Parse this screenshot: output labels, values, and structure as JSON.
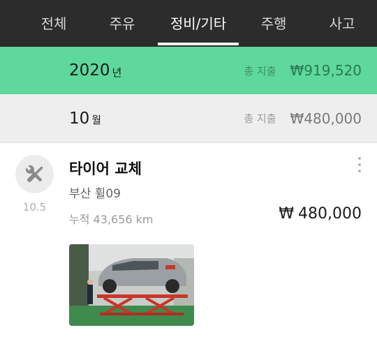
{
  "tabs": [
    {
      "label": "전체"
    },
    {
      "label": "주유"
    },
    {
      "label": "정비/기타"
    },
    {
      "label": "주행"
    },
    {
      "label": "사고"
    }
  ],
  "active_tab": "정비/기타",
  "year_summary": {
    "year": "2020",
    "unit": "년",
    "total_label": "총 지출",
    "total_amount": "₩919,520"
  },
  "month_summary": {
    "month": "10",
    "unit": "월",
    "total_label": "총 지출",
    "total_amount": "₩480,000"
  },
  "entry": {
    "icon": "wrench-screwdriver-icon",
    "date": "10.5",
    "title": "타이어 교체",
    "place": "부산 휠09",
    "odometer": "누적 43,656 km",
    "currency": "₩",
    "amount": "480,000",
    "photo": "car-on-lift-photo"
  },
  "colors": {
    "tabbar": "#2c2c2c",
    "year_row": "#5ed89c",
    "month_row": "#eeeeee"
  }
}
